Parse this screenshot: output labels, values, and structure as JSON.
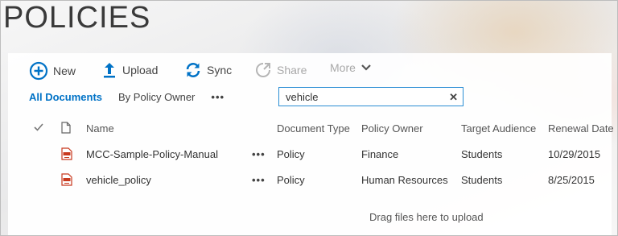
{
  "page": {
    "title": "POLICIES"
  },
  "toolbar": {
    "new_label": "New",
    "upload_label": "Upload",
    "sync_label": "Sync",
    "share_label": "Share",
    "more_label": "More"
  },
  "views": {
    "items": [
      "All Documents",
      "By Policy Owner"
    ],
    "active_index": 0,
    "overflow": "•••"
  },
  "search": {
    "value": "vehicle",
    "clear_glyph": "✕"
  },
  "table": {
    "columns": [
      "Name",
      "Document Type",
      "Policy Owner",
      "Target Audience",
      "Renewal Date"
    ],
    "rows": [
      {
        "name": "MCC-Sample-Policy-Manual",
        "document_type": "Policy",
        "policy_owner": "Finance",
        "target_audience": "Students",
        "renewal_date": "10/29/2015"
      },
      {
        "name": "vehicle_policy",
        "document_type": "Policy",
        "policy_owner": "Human Resources",
        "target_audience": "Students",
        "renewal_date": "8/25/2015"
      }
    ],
    "row_menu": "•••"
  },
  "upload_hint": "Drag files here to upload",
  "colors": {
    "accent": "#0072c6",
    "pdf_icon": "#c8391e"
  }
}
